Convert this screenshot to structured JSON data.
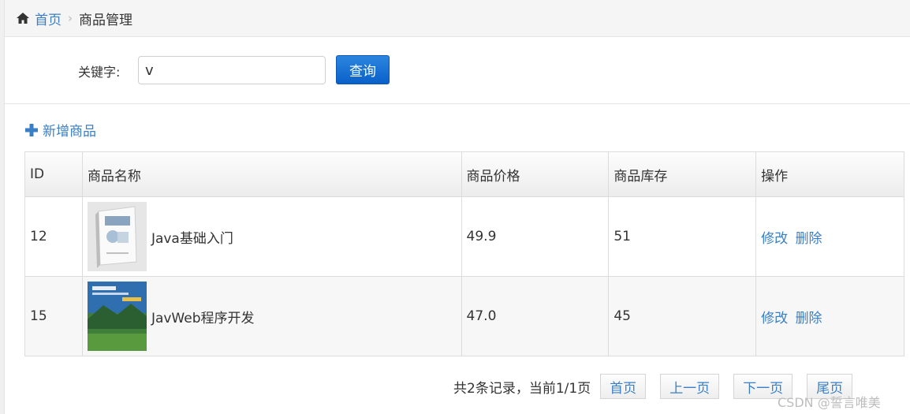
{
  "breadcrumb": {
    "home_icon": "home-icon",
    "home_label": "首页",
    "current_label": "商品管理"
  },
  "search": {
    "label": "关键字:",
    "value": "v",
    "button_label": "查询"
  },
  "toolbar": {
    "add_icon": "plus-icon",
    "add_label": "新增商品"
  },
  "table": {
    "headers": [
      "ID",
      "商品名称",
      "商品价格",
      "商品库存",
      "操作"
    ],
    "rows": [
      {
        "id": "12",
        "name": "Java基础入门",
        "price": "49.9",
        "stock": "51",
        "edit_label": "修改",
        "delete_label": "删除"
      },
      {
        "id": "15",
        "name": "JavWeb程序开发",
        "price": "47.0",
        "stock": "45",
        "edit_label": "修改",
        "delete_label": "删除"
      }
    ]
  },
  "pagination": {
    "info": "共2条记录，当前1/1页",
    "first_label": "首页",
    "prev_label": "上一页",
    "next_label": "下一页",
    "last_label": "尾页"
  },
  "watermark": "CSDN @誓言唯美",
  "colors": {
    "link": "#3a7fc4",
    "button": "#0a60c9"
  }
}
